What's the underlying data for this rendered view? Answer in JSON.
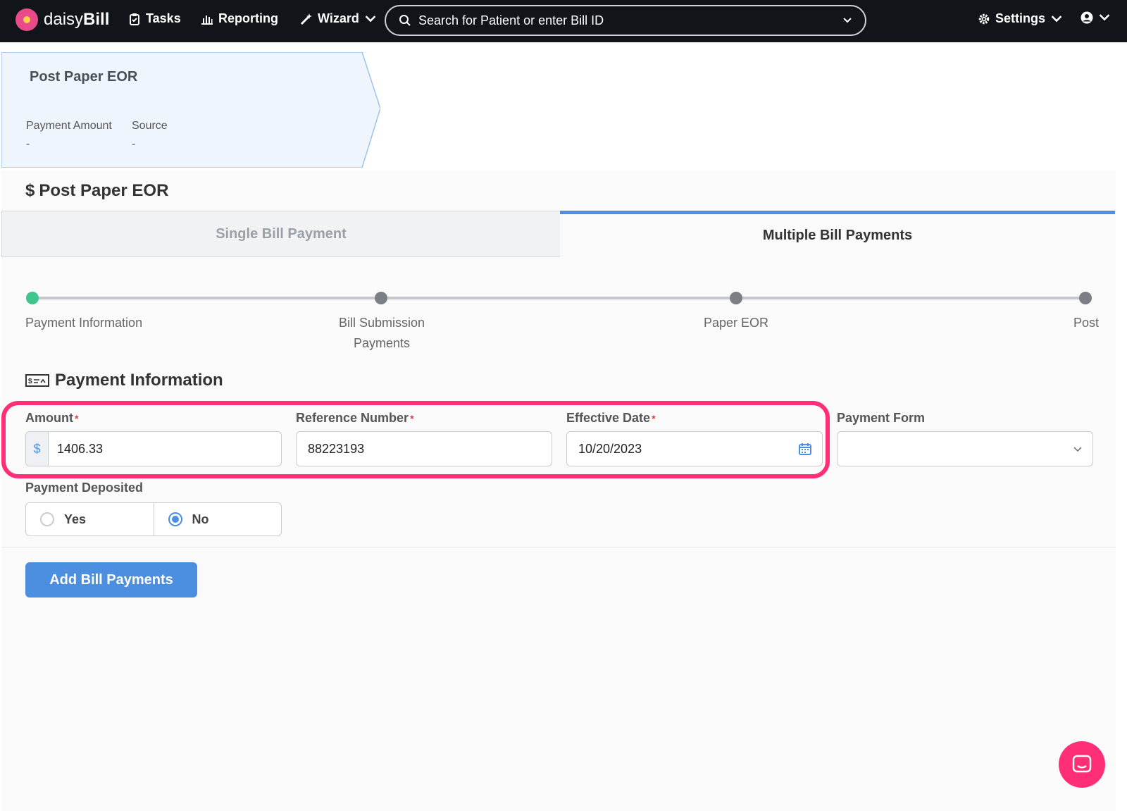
{
  "nav": {
    "logo_prefix": "daisy",
    "logo_bold": "Bill",
    "tasks": "Tasks",
    "reporting": "Reporting",
    "wizard": "Wizard",
    "search_placeholder": "Search for Patient or enter Bill ID",
    "settings": "Settings"
  },
  "card": {
    "title": "Post Paper EOR",
    "payment_amount_label": "Payment Amount",
    "payment_amount_value": "-",
    "source_label": "Source",
    "source_value": "-"
  },
  "section": {
    "icon": "$",
    "title": "Post Paper EOR"
  },
  "tabs": {
    "single": "Single Bill Payment",
    "multiple": "Multiple Bill Payments",
    "active": "multiple"
  },
  "steps": [
    "Payment Information",
    "Bill Submission Payments",
    "Paper EOR",
    "Post"
  ],
  "active_step": 0,
  "form": {
    "title": "Payment Information",
    "amount_label": "Amount",
    "amount_currency": "$",
    "amount_value": "1406.33",
    "reference_label": "Reference Number",
    "reference_value": "88223193",
    "date_label": "Effective Date",
    "date_value": "10/20/2023",
    "payment_form_label": "Payment Form",
    "payment_form_value": "",
    "required_mark": "*",
    "deposited_label": "Payment Deposited",
    "deposited_yes": "Yes",
    "deposited_no": "No",
    "deposited_selected": "No"
  },
  "actions": {
    "add_bill_payments": "Add Bill Payments"
  },
  "colors": {
    "accent": "#4c8fe0",
    "highlight": "#ff2e77",
    "step_active": "#3fc58e",
    "nav_bg": "#111418"
  }
}
